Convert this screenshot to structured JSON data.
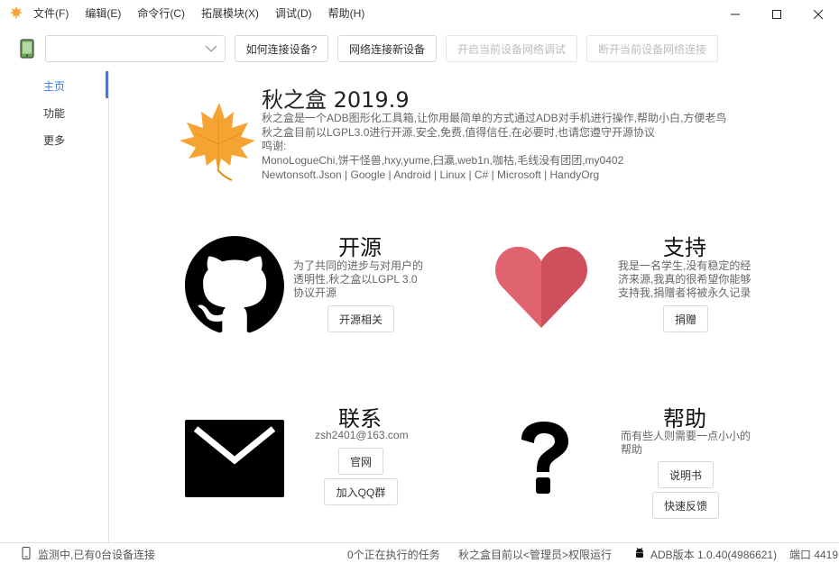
{
  "menu": {
    "items": [
      "文件(F)",
      "编辑(E)",
      "命令行(C)",
      "拓展模块(X)",
      "调试(D)",
      "帮助(H)"
    ]
  },
  "toolbar": {
    "device_combo_value": "",
    "btn_how_connect": "如何连接设备?",
    "btn_network_connect": "网络连接新设备",
    "btn_open_network_debug": "开启当前设备网络调试",
    "btn_disconnect_network": "断开当前设备网络连接"
  },
  "sidenav": {
    "items": [
      "主页",
      "功能",
      "更多"
    ],
    "active_index": 0,
    "accent_color": "#3d7be0"
  },
  "about": {
    "title": "秋之盒 2019.9",
    "lines": [
      "秋之盒是一个ADB图形化工具箱,让你用最简单的方式通过ADB对手机进行操作,帮助小白,方便老鸟",
      "秋之盒目前以LGPL3.0进行开源,安全,免费,值得信任,在必要时,也请您遵守开源协议",
      "鸣谢:",
      "MonoLogueChi,饼干怪兽,hxy,yume,臼瀛,web1n,咖枯,毛线没有团团,my0402",
      "Newtonsoft.Json  | Google | Android | Linux | C# | Microsoft | HandyOrg"
    ],
    "leaf_color": "#f5a433"
  },
  "cards": {
    "opensource": {
      "title": "开源",
      "desc": [
        "为了共同的进步与对用户的",
        "透明性,秋之盒以LGPL 3.0",
        "协议开源"
      ],
      "button": "开源相关"
    },
    "support": {
      "title": "支持",
      "desc": [
        "我是一名学生,没有稳定的经",
        "济来源,我真的很希望你能够",
        "支持我,捐赠者将被永久记录"
      ],
      "button": "捐赠",
      "heart_color": "#d9535f"
    },
    "contact": {
      "title": "联系",
      "desc": [
        "zsh2401@163.com"
      ],
      "button_site": "官网",
      "button_qq": "加入QQ群"
    },
    "help": {
      "title": "帮助",
      "desc": [
        "而有些人则需要一点小小的",
        "帮助"
      ],
      "button_manual": "说明书",
      "button_feedback": "快速反馈"
    }
  },
  "statusbar": {
    "monitor": "监测中,已有0台设备连接",
    "tasks": "0个正在执行的任务",
    "privilege": "秋之盒目前以<管理员>权限运行",
    "adb_version": "ADB版本 1.0.40(4986621)",
    "port": "端口 4419"
  }
}
